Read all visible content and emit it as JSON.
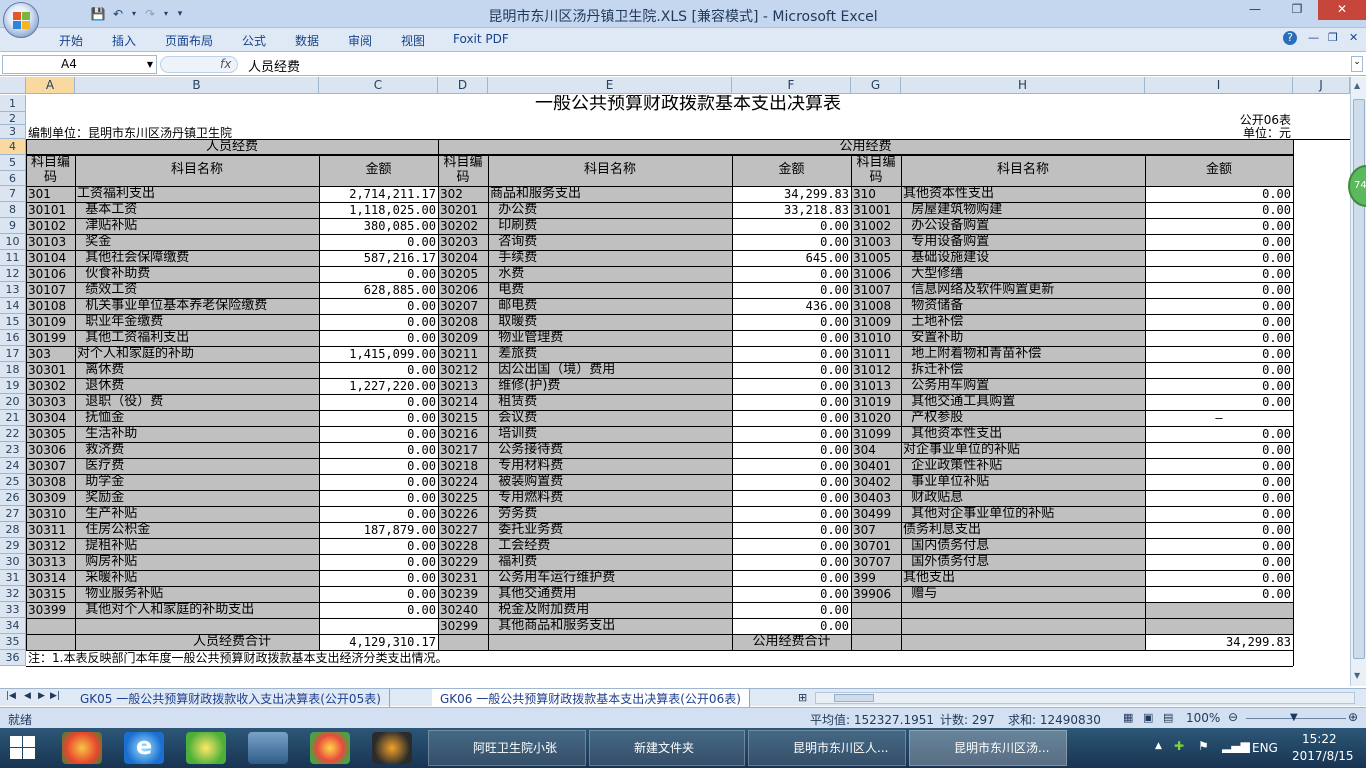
{
  "window": {
    "title": "昆明市东川区汤丹镇卫生院.XLS  [兼容模式] - Microsoft Excel",
    "minimize": "—",
    "restore": "❐",
    "close": "✕"
  },
  "ribbon": {
    "tabs": [
      "开始",
      "插入",
      "页面布局",
      "公式",
      "数据",
      "审阅",
      "视图",
      "Foxit PDF"
    ]
  },
  "formula_bar": {
    "name_box": "A4",
    "fx": "fx",
    "content": "人员经费"
  },
  "columns": [
    "A",
    "B",
    "C",
    "D",
    "E",
    "F",
    "G",
    "H",
    "I",
    "J"
  ],
  "rows": [
    "1",
    "2",
    "3",
    "4",
    "5",
    "6",
    "7",
    "8",
    "9",
    "10",
    "11",
    "12",
    "13",
    "14",
    "15",
    "16",
    "17",
    "18",
    "19",
    "20",
    "21",
    "22",
    "23",
    "24",
    "25",
    "26",
    "27",
    "28",
    "29",
    "30",
    "31",
    "32",
    "33",
    "34",
    "35",
    "36"
  ],
  "sheet": {
    "title": "一般公共预算财政拨款基本支出决算表",
    "code": "公开06表",
    "unit_label": "编制单位：昆明市东川区汤丹镇卫生院",
    "unit": "单位：元",
    "personnel_header": "人员经费",
    "public_header": "公用经费",
    "col_code": "科目编码",
    "col_name": "科目名称",
    "col_amount": "金额",
    "personnel_total_label": "人员经费合计",
    "personnel_total": "4,129,310.17",
    "public_total_label": "公用经费合计",
    "public_total": "34,299.83",
    "note": "注：1.本表反映部门本年度一般公共预算财政拨款基本支出经济分类支出情况。",
    "personnel": [
      [
        "301",
        "工资福利支出",
        "2,714,211.17"
      ],
      [
        "30101",
        "  基本工资",
        "1,118,025.00"
      ],
      [
        "30102",
        "  津贴补贴",
        "380,085.00"
      ],
      [
        "30103",
        "  奖金",
        "0.00"
      ],
      [
        "30104",
        "  其他社会保障缴费",
        "587,216.17"
      ],
      [
        "30106",
        "  伙食补助费",
        "0.00"
      ],
      [
        "30107",
        "  绩效工资",
        "628,885.00"
      ],
      [
        "30108",
        "  机关事业单位基本养老保险缴费",
        "0.00"
      ],
      [
        "30109",
        "  职业年金缴费",
        "0.00"
      ],
      [
        "30199",
        "  其他工资福利支出",
        "0.00"
      ],
      [
        "303",
        "对个人和家庭的补助",
        "1,415,099.00"
      ],
      [
        "30301",
        "  离休费",
        "0.00"
      ],
      [
        "30302",
        "  退休费",
        "1,227,220.00"
      ],
      [
        "30303",
        "  退职（役）费",
        "0.00"
      ],
      [
        "30304",
        "  抚恤金",
        "0.00"
      ],
      [
        "30305",
        "  生活补助",
        "0.00"
      ],
      [
        "30306",
        "  救济费",
        "0.00"
      ],
      [
        "30307",
        "  医疗费",
        "0.00"
      ],
      [
        "30308",
        "  助学金",
        "0.00"
      ],
      [
        "30309",
        "  奖励金",
        "0.00"
      ],
      [
        "30310",
        "  生产补贴",
        "0.00"
      ],
      [
        "30311",
        "  住房公积金",
        "187,879.00"
      ],
      [
        "30312",
        "  提租补贴",
        "0.00"
      ],
      [
        "30313",
        "  购房补贴",
        "0.00"
      ],
      [
        "30314",
        "  采暖补贴",
        "0.00"
      ],
      [
        "30315",
        "  物业服务补贴",
        "0.00"
      ],
      [
        "30399",
        "  其他对个人和家庭的补助支出",
        "0.00"
      ],
      [
        "",
        "",
        ""
      ]
    ],
    "public1": [
      [
        "302",
        "商品和服务支出",
        "34,299.83"
      ],
      [
        "30201",
        "  办公费",
        "33,218.83"
      ],
      [
        "30202",
        "  印刷费",
        "0.00"
      ],
      [
        "30203",
        "  咨询费",
        "0.00"
      ],
      [
        "30204",
        "  手续费",
        "645.00"
      ],
      [
        "30205",
        "  水费",
        "0.00"
      ],
      [
        "30206",
        "  电费",
        "0.00"
      ],
      [
        "30207",
        "  邮电费",
        "436.00"
      ],
      [
        "30208",
        "  取暖费",
        "0.00"
      ],
      [
        "30209",
        "  物业管理费",
        "0.00"
      ],
      [
        "30211",
        "  差旅费",
        "0.00"
      ],
      [
        "30212",
        "  因公出国（境）费用",
        "0.00"
      ],
      [
        "30213",
        "  维修(护)费",
        "0.00"
      ],
      [
        "30214",
        "  租赁费",
        "0.00"
      ],
      [
        "30215",
        "  会议费",
        "0.00"
      ],
      [
        "30216",
        "  培训费",
        "0.00"
      ],
      [
        "30217",
        "  公务接待费",
        "0.00"
      ],
      [
        "30218",
        "  专用材料费",
        "0.00"
      ],
      [
        "30224",
        "  被装购置费",
        "0.00"
      ],
      [
        "30225",
        "  专用燃料费",
        "0.00"
      ],
      [
        "30226",
        "  劳务费",
        "0.00"
      ],
      [
        "30227",
        "  委托业务费",
        "0.00"
      ],
      [
        "30228",
        "  工会经费",
        "0.00"
      ],
      [
        "30229",
        "  福利费",
        "0.00"
      ],
      [
        "30231",
        "  公务用车运行维护费",
        "0.00"
      ],
      [
        "30239",
        "  其他交通费用",
        "0.00"
      ],
      [
        "30240",
        "  税金及附加费用",
        "0.00"
      ],
      [
        "30299",
        "  其他商品和服务支出",
        "0.00"
      ]
    ],
    "public2": [
      [
        "310",
        "其他资本性支出",
        "0.00"
      ],
      [
        "31001",
        "  房屋建筑物购建",
        "0.00"
      ],
      [
        "31002",
        "  办公设备购置",
        "0.00"
      ],
      [
        "31003",
        "  专用设备购置",
        "0.00"
      ],
      [
        "31005",
        "  基础设施建设",
        "0.00"
      ],
      [
        "31006",
        "  大型修缮",
        "0.00"
      ],
      [
        "31007",
        "  信息网络及软件购置更新",
        "0.00"
      ],
      [
        "31008",
        "  物资储备",
        "0.00"
      ],
      [
        "31009",
        "  土地补偿",
        "0.00"
      ],
      [
        "31010",
        "  安置补助",
        "0.00"
      ],
      [
        "31011",
        "  地上附着物和青苗补偿",
        "0.00"
      ],
      [
        "31012",
        "  拆迁补偿",
        "0.00"
      ],
      [
        "31013",
        "  公务用车购置",
        "0.00"
      ],
      [
        "31019",
        "  其他交通工具购置",
        "0.00"
      ],
      [
        "31020",
        "  产权参股",
        "—"
      ],
      [
        "31099",
        "  其他资本性支出",
        "0.00"
      ],
      [
        "304",
        "对企事业单位的补贴",
        "0.00"
      ],
      [
        "30401",
        "  企业政策性补贴",
        "0.00"
      ],
      [
        "30402",
        "  事业单位补贴",
        "0.00"
      ],
      [
        "30403",
        "  财政贴息",
        "0.00"
      ],
      [
        "30499",
        "  其他对企事业单位的补贴",
        "0.00"
      ],
      [
        "307",
        "债务利息支出",
        "0.00"
      ],
      [
        "30701",
        "  国内债务付息",
        "0.00"
      ],
      [
        "30707",
        "  国外债务付息",
        "0.00"
      ],
      [
        "399",
        "其他支出",
        "0.00"
      ],
      [
        "39906",
        "  赠与",
        "0.00"
      ],
      [
        "",
        "",
        ""
      ],
      [
        "",
        "",
        ""
      ]
    ]
  },
  "sheet_tabs": [
    "GK05 一般公共预算财政拨款收入支出决算表(公开05表)",
    "GK06 一般公共预算财政拨款基本支出决算表(公开06表)"
  ],
  "status": {
    "ready": "就绪",
    "average": "平均值: 152327.1951",
    "count": "计数: 297",
    "sum": "求和: 12490830",
    "zoom": "100%"
  },
  "scroll_badge": "74",
  "taskbar": {
    "tasks": [
      "阿旺卫生院小张",
      "新建文件夹",
      "昆明市东川区人...",
      "昆明市东川区汤..."
    ],
    "lang": "ENG",
    "time": "15:22",
    "date": "2017/8/15"
  }
}
